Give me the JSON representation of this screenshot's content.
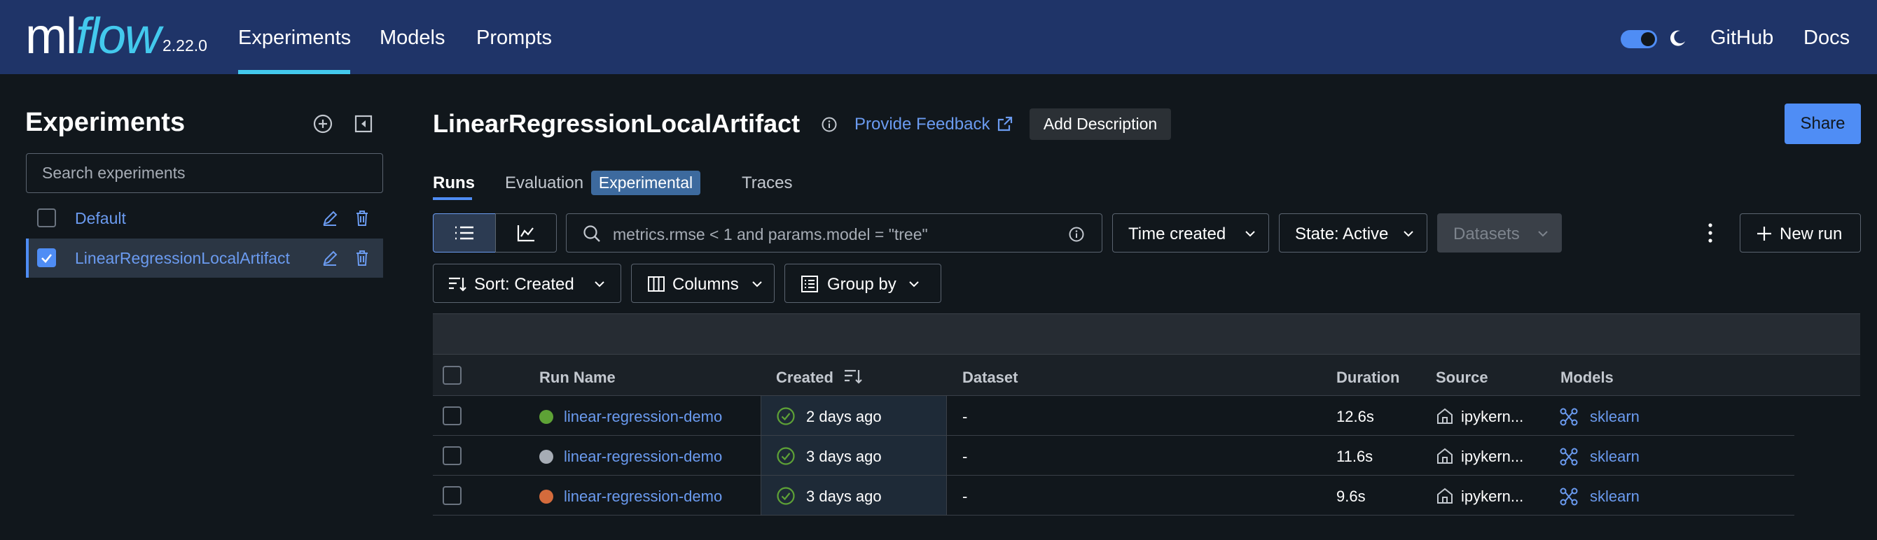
{
  "topbar": {
    "logo_ml": "ml",
    "logo_flow": "flow",
    "version": "2.22.0",
    "nav": [
      {
        "label": "Experiments"
      },
      {
        "label": "Models"
      },
      {
        "label": "Prompts"
      }
    ],
    "active_nav": "Experiments",
    "dark_mode_on": true,
    "github": "GitHub",
    "docs": "Docs"
  },
  "sidebar": {
    "title": "Experiments",
    "search_placeholder": "Search experiments",
    "experiments": [
      {
        "name": "Default",
        "checked": false
      },
      {
        "name": "LinearRegressionLocalArtifact",
        "checked": true
      }
    ]
  },
  "main": {
    "title": "LinearRegressionLocalArtifact",
    "feedback": "Provide Feedback",
    "add_description": "Add Description",
    "share": "Share",
    "tabs": [
      {
        "label": "Runs"
      },
      {
        "label": "Evaluation"
      },
      {
        "label": "Traces"
      }
    ],
    "evaluation_badge": "Experimental",
    "search_placeholder": "metrics.rmse < 1 and params.model = \"tree\"",
    "time_filter": "Time created",
    "state_filter": "State: Active",
    "datasets_filter": "Datasets",
    "new_run": "New run",
    "sort": "Sort: Created",
    "columns": "Columns",
    "group_by": "Group by"
  },
  "table": {
    "headers": [
      "Run Name",
      "Created",
      "Dataset",
      "Duration",
      "Source",
      "Models"
    ],
    "rows": [
      {
        "run": "linear-regression-demo",
        "color": "#5ea236",
        "created": "2 days ago",
        "dataset": "-",
        "duration": "12.6s",
        "source": "ipykern...",
        "model": "sklearn"
      },
      {
        "run": "linear-regression-demo",
        "color": "#a6acb5",
        "created": "3 days ago",
        "dataset": "-",
        "duration": "11.6s",
        "source": "ipykern...",
        "model": "sklearn"
      },
      {
        "run": "linear-regression-demo",
        "color": "#d46b3c",
        "created": "3 days ago",
        "dataset": "-",
        "duration": "9.6s",
        "source": "ipykern...",
        "model": "sklearn"
      }
    ]
  },
  "colors": {
    "topbar": "#1f3468",
    "background": "#11171c",
    "accent": "#4f8df5",
    "link": "#6b9bf0",
    "success": "#5ea236"
  }
}
